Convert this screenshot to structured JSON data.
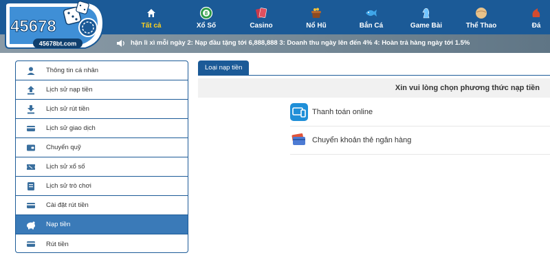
{
  "brand": {
    "logo_text": "45678",
    "logo_domain": "45678bt.com"
  },
  "nav": [
    {
      "label": "Tất cả",
      "icon": "home-icon",
      "active": true
    },
    {
      "label": "Xổ Số",
      "icon": "lottery-ball-icon"
    },
    {
      "label": "Casino",
      "icon": "playing-cards-icon"
    },
    {
      "label": "Nổ Hũ",
      "icon": "slot-pot-icon"
    },
    {
      "label": "Bắn Cá",
      "icon": "fish-icon"
    },
    {
      "label": "Game Bài",
      "icon": "chess-knight-icon"
    },
    {
      "label": "Thể Thao",
      "icon": "sport-ball-icon"
    },
    {
      "label": "Đá",
      "icon": "cockfight-icon"
    }
  ],
  "marquee": {
    "icon": "speaker-icon",
    "text": "hận lì xì mỗi ngày 2: Nạp đầu tặng tới 6,888,888 3: Doanh thu ngày lên đến 4% 4: Hoàn trả hàng ngày tới 1.5%"
  },
  "sidebar": {
    "items": [
      {
        "label": "Thông tin cá nhân",
        "icon": "user-icon"
      },
      {
        "label": "Lịch sử nạp tiền",
        "icon": "upload-icon"
      },
      {
        "label": "Lịch sử rút tiền",
        "icon": "download-icon"
      },
      {
        "label": "Lịch sử giao dịch",
        "icon": "card-icon"
      },
      {
        "label": "Chuyển quỹ",
        "icon": "wallet-icon"
      },
      {
        "label": "Lịch sử xổ số",
        "icon": "lottery-ticket-icon"
      },
      {
        "label": "Lịch sử trò chơi",
        "icon": "game-history-icon"
      },
      {
        "label": "Cài đặt rút tiền",
        "icon": "bank-card-icon"
      },
      {
        "label": "Nạp tiền",
        "icon": "piggy-bank-icon",
        "active": true
      },
      {
        "label": "Rút tiền",
        "icon": "withdraw-card-icon"
      }
    ]
  },
  "main": {
    "tab_label": "Loại nạp tiền",
    "choose_text": "Xin vui lòng chọn phương thức nạp tiền",
    "methods": [
      {
        "label": "Thanh toán online",
        "icon": "online-payment-icon"
      },
      {
        "label": "Chuyển khoản thẻ ngân hàng",
        "icon": "bank-transfer-icon"
      }
    ]
  },
  "colors": {
    "header": "#1b5a97",
    "active_nav": "#ffd21f",
    "sidebar_active": "#3a7ab8"
  }
}
